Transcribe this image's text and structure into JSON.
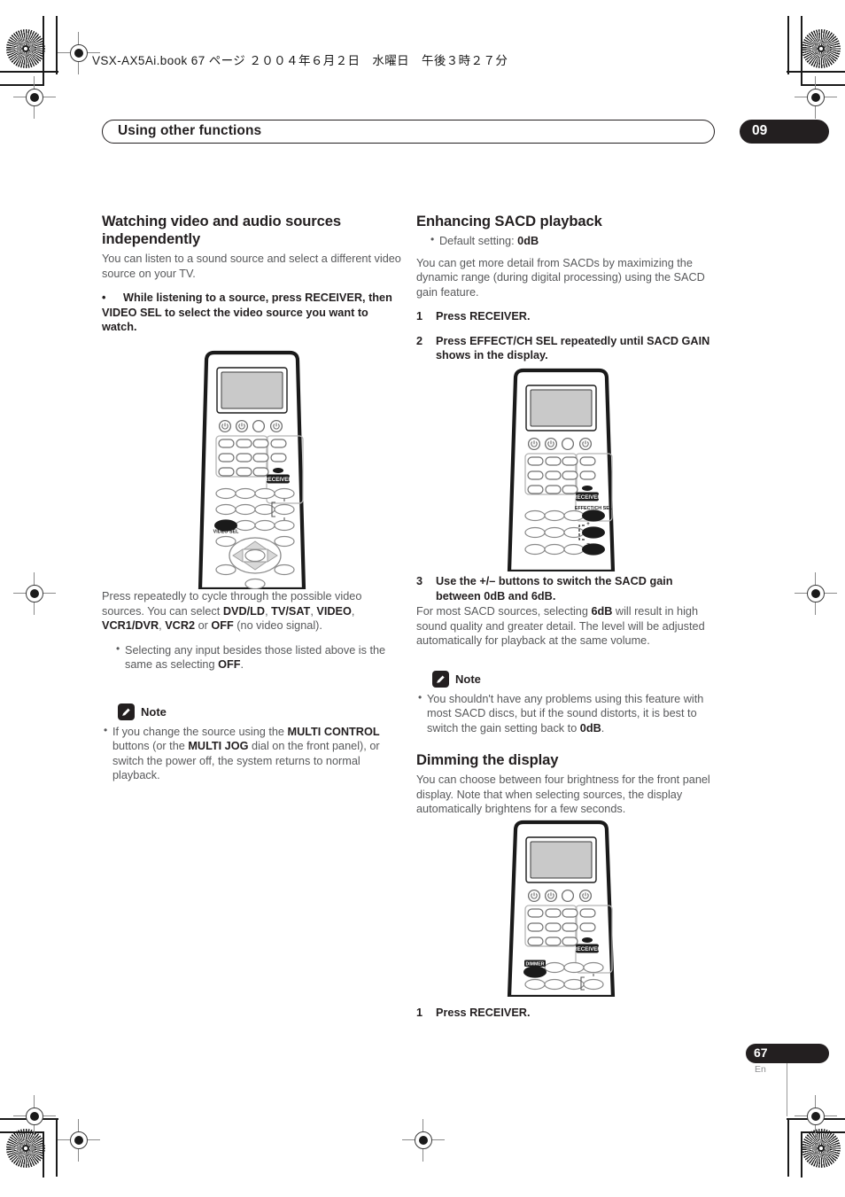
{
  "header": {
    "book_line": "VSX-AX5Ai.book  67 ページ  ２００４年６月２日　水曜日　午後３時２７分"
  },
  "running_head": {
    "title": "Using other functions",
    "chapter": "09"
  },
  "left_column": {
    "section_title": "Watching video and audio sources independently",
    "intro": "You can listen to a sound source and select a different video source on your TV.",
    "bullet_marker": "•",
    "instruction_bold": "While listening to a source, press RECEIVER, then VIDEO SEL to select the video source you want to watch.",
    "after_figure_p1_a": "Press repeatedly to cycle through the possible video sources. You can select ",
    "after_figure_b1": "DVD/LD",
    "after_figure_sep1": ", ",
    "after_figure_b2": "TV/SAT",
    "after_figure_sep2": ", ",
    "after_figure_b3": "VIDEO",
    "after_figure_sep3": ", ",
    "after_figure_b4": "VCR1/DVR",
    "after_figure_sep4": ", ",
    "after_figure_b5": "VCR2",
    "after_figure_sep5": " or ",
    "after_figure_b6": "OFF",
    "after_figure_tail": " (no video signal).",
    "sub_bullet_a": "Selecting any input besides those listed above is the same as selecting ",
    "sub_bullet_b": "OFF",
    "sub_bullet_tail": ".",
    "note_label": "Note",
    "note_a": "If you change the source using the ",
    "note_b1": "MULTI CONTROL",
    "note_c": " buttons (or the ",
    "note_b2": "MULTI JOG",
    "note_d": " dial on the front panel), or switch the power off, the system returns to normal playback."
  },
  "right_column": {
    "section_title": "Enhancing SACD playback",
    "default_setting_a": "Default setting: ",
    "default_setting_b": "0dB",
    "intro": "You can get more detail from SACDs by maximizing the dynamic range (during digital processing) using the SACD gain feature.",
    "step1_num": "1",
    "step1_text": "Press RECEIVER.",
    "step2_num": "2",
    "step2_text": "Press EFFECT/CH SEL repeatedly until SACD GAIN shows in the display.",
    "step3_num": "3",
    "step3_text": "Use the +/– buttons to switch the SACD gain between 0dB and 6dB.",
    "step3_body_a": "For most SACD sources, selecting ",
    "step3_body_b": "6dB",
    "step3_body_c": " will result in high sound quality and greater detail. The level will be adjusted automatically for playback at the same volume.",
    "note_label": "Note",
    "note_a": "You shouldn't have any problems using this feature with most SACD discs, but if the sound distorts, it is best to switch the gain setting back to ",
    "note_b": "0dB",
    "note_tail": ".",
    "dim_title": "Dimming the display",
    "dim_intro": "You can choose between four brightness for the front panel display. Note that when selecting sources, the display automatically brightens for a few seconds.",
    "dim_step1_num": "1",
    "dim_step1_text": "Press RECEIVER."
  },
  "remotes": {
    "remote1_label_receiver": "RECEIVER",
    "remote1_label_videosel": "VIDEO SEL",
    "remote2_label_receiver": "RECEIVER",
    "remote2_label_effect": "EFFECT/CH SEL",
    "remote2_label_plus": "+",
    "remote2_label_minus": "–",
    "remote3_label_receiver": "RECEIVER",
    "remote3_label_dimmer": "DIMMER"
  },
  "footer": {
    "page_number": "67",
    "language": "En"
  },
  "colors": {
    "ink": "#231f20",
    "body_gray": "#58595b",
    "screen_gray": "#c9c9c9"
  }
}
